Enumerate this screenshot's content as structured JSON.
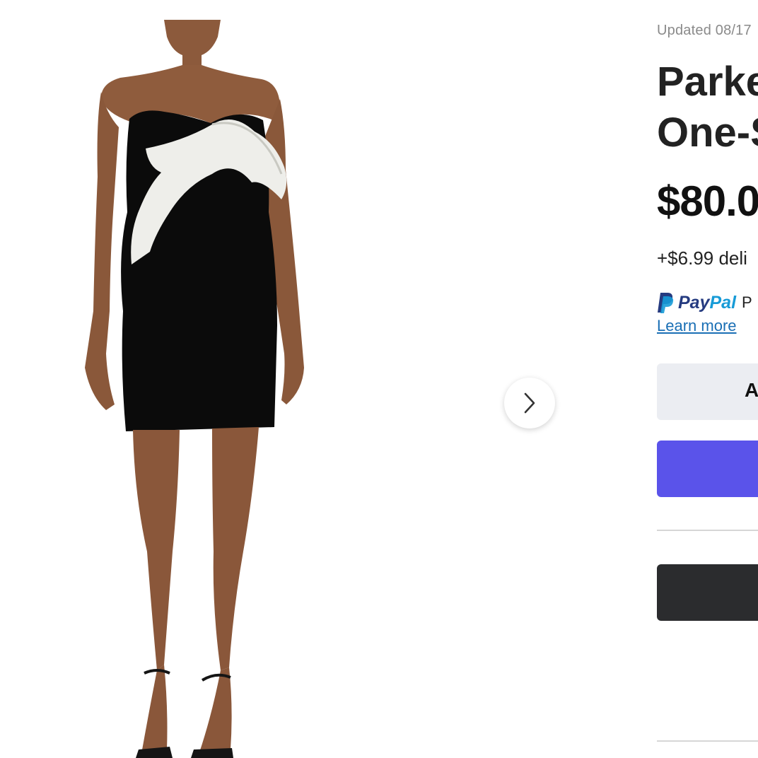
{
  "gallery": {
    "image_alt": "Black strapless mini dress with white one-shoulder ruffle",
    "next_icon": "chevron-right-icon"
  },
  "details": {
    "updated_text": "Updated 08/17",
    "title_line_1": "Parke",
    "title_line_2": "One-S",
    "price": "$80.0",
    "delivery": "+$6.99 deli",
    "paypal_brand_pay": "Pay",
    "paypal_brand_pal": "Pal",
    "paypal_tail": "P",
    "learn_more": "Learn more",
    "cart_button_label": "A"
  },
  "colors": {
    "paypal_button": "#5a53ea",
    "cart_button": "#ebedf2",
    "dark_button": "#2b2c2e",
    "link": "#1a6fb5",
    "paypal_dark_blue": "#253b80",
    "paypal_light_blue": "#179bd7"
  }
}
